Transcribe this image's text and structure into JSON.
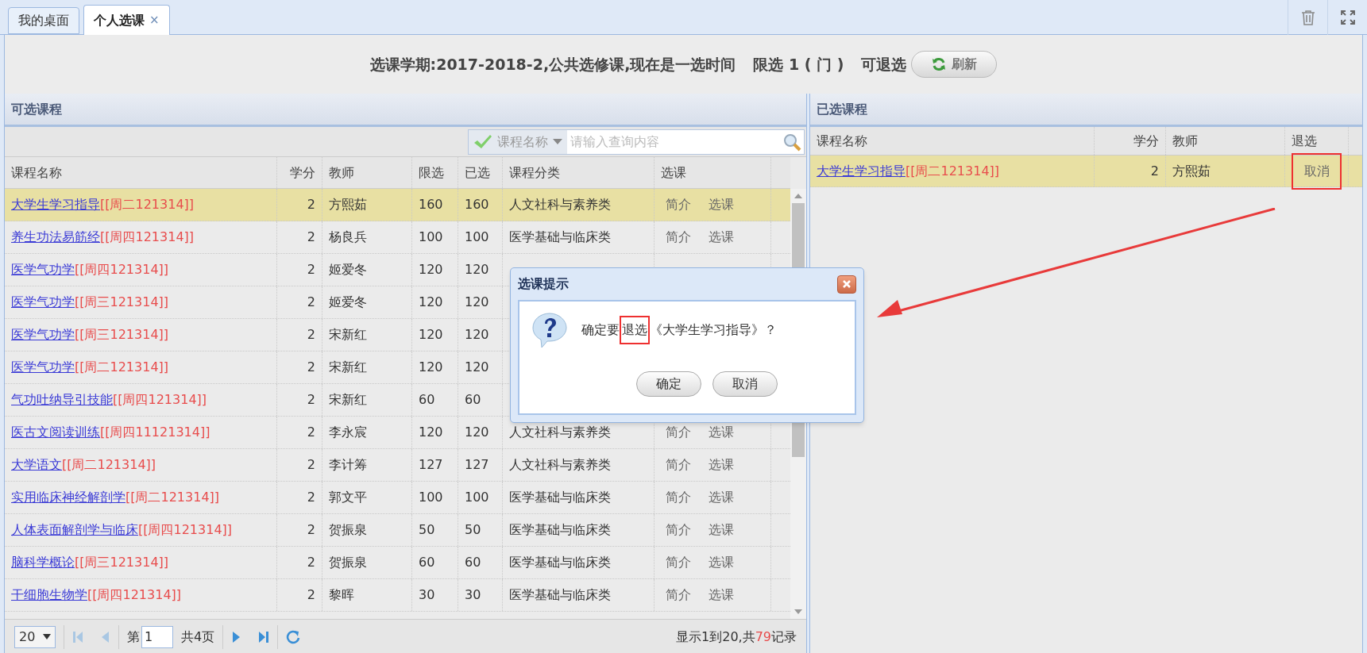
{
  "tabs": [
    {
      "label": "我的桌面",
      "selected": false
    },
    {
      "label": "个人选课",
      "selected": true,
      "close": "×"
    }
  ],
  "header": {
    "info": "选课学期:2017-2018-2,公共选修课,现在是一选时间",
    "limit": "限选 1 ( 门 )",
    "withdraw": "可退选",
    "refresh": "刷新"
  },
  "available": {
    "title": "可选课程",
    "search_field": "课程名称",
    "search_placeholder": "请输入查询内容",
    "columns": [
      "课程名称",
      "学分",
      "教师",
      "限选",
      "已选",
      "课程分类",
      "选课"
    ],
    "rows": [
      {
        "course": "大学生学习指导",
        "schedule": "[[周二121314]]",
        "credits": "2",
        "teacher": "方熙茹",
        "limit": "160",
        "chosen": "160",
        "category": "人文社科与素养类",
        "actions": [
          "简介",
          "选课"
        ],
        "selected": true
      },
      {
        "course": "养生功法易筋经",
        "schedule": "[[周四121314]]",
        "credits": "2",
        "teacher": "杨良兵",
        "limit": "100",
        "chosen": "100",
        "category": "医学基础与临床类",
        "actions": [
          "简介",
          "选课"
        ],
        "selected": false
      },
      {
        "course": "医学气功学",
        "schedule": "[[周四121314]]",
        "credits": "2",
        "teacher": "姬爱冬",
        "limit": "120",
        "chosen": "120",
        "selected": false
      },
      {
        "course": "医学气功学",
        "schedule": "[[周三121314]]",
        "credits": "2",
        "teacher": "姬爱冬",
        "limit": "120",
        "chosen": "120",
        "selected": false
      },
      {
        "course": "医学气功学",
        "schedule": "[[周三121314]]",
        "credits": "2",
        "teacher": "宋新红",
        "limit": "120",
        "chosen": "120",
        "selected": false
      },
      {
        "course": "医学气功学",
        "schedule": "[[周二121314]]",
        "credits": "2",
        "teacher": "宋新红",
        "limit": "120",
        "chosen": "120",
        "selected": false
      },
      {
        "course": "气功吐纳导引技能",
        "schedule": "[[周四121314]]",
        "credits": "2",
        "teacher": "宋新红",
        "limit": "60",
        "chosen": "60",
        "selected": false
      },
      {
        "course": "医古文阅读训练",
        "schedule": "[[周四11121314]]",
        "credits": "2",
        "teacher": "李永宸",
        "limit": "120",
        "chosen": "120",
        "category": "人文社科与素养类",
        "actions": [
          "简介",
          "选课"
        ],
        "selected": false
      },
      {
        "course": "大学语文",
        "schedule": "[[周二121314]]",
        "credits": "2",
        "teacher": "李计筹",
        "limit": "127",
        "chosen": "127",
        "category": "人文社科与素养类",
        "actions": [
          "简介",
          "选课"
        ],
        "selected": false
      },
      {
        "course": "实用临床神经解剖学",
        "schedule": "[[周二121314]]",
        "credits": "2",
        "teacher": "郭文平",
        "limit": "100",
        "chosen": "100",
        "category": "医学基础与临床类",
        "actions": [
          "简介",
          "选课"
        ],
        "selected": false
      },
      {
        "course": "人体表面解剖学与临床",
        "schedule": "[[周四121314]]",
        "credits": "2",
        "teacher": "贺振泉",
        "limit": "50",
        "chosen": "50",
        "category": "医学基础与临床类",
        "actions": [
          "简介",
          "选课"
        ],
        "selected": false
      },
      {
        "course": "脑科学概论",
        "schedule": "[[周三121314]]",
        "credits": "2",
        "teacher": "贺振泉",
        "limit": "60",
        "chosen": "60",
        "category": "医学基础与临床类",
        "actions": [
          "简介",
          "选课"
        ],
        "selected": false
      },
      {
        "course": "干细胞生物学",
        "schedule": "[[周四121314]]",
        "credits": "2",
        "teacher": "黎晖",
        "limit": "30",
        "chosen": "30",
        "category": "医学基础与临床类",
        "actions": [
          "简介",
          "选课"
        ],
        "selected": false
      }
    ],
    "pager": {
      "page_size": "20",
      "page_label": "第",
      "page": "1",
      "total_pages": "共4页",
      "record_before": "显示1到20,共",
      "record_count": "79",
      "record_after": "记录"
    }
  },
  "chosen": {
    "title": "已选课程",
    "columns": [
      "课程名称",
      "学分",
      "教师",
      "退选"
    ],
    "rows": [
      {
        "course": "大学生学习指导",
        "schedule": "[[周二121314]]",
        "credits": "2",
        "teacher": "方熙茹",
        "action": "取消",
        "selected": true,
        "highlighted": true
      }
    ]
  },
  "dialog": {
    "title": "选课提示",
    "message_before": "确定要",
    "message_highlight": "退选",
    "message_after": "《大学生学习指导》？",
    "buttons": [
      "确定",
      "取消"
    ]
  }
}
